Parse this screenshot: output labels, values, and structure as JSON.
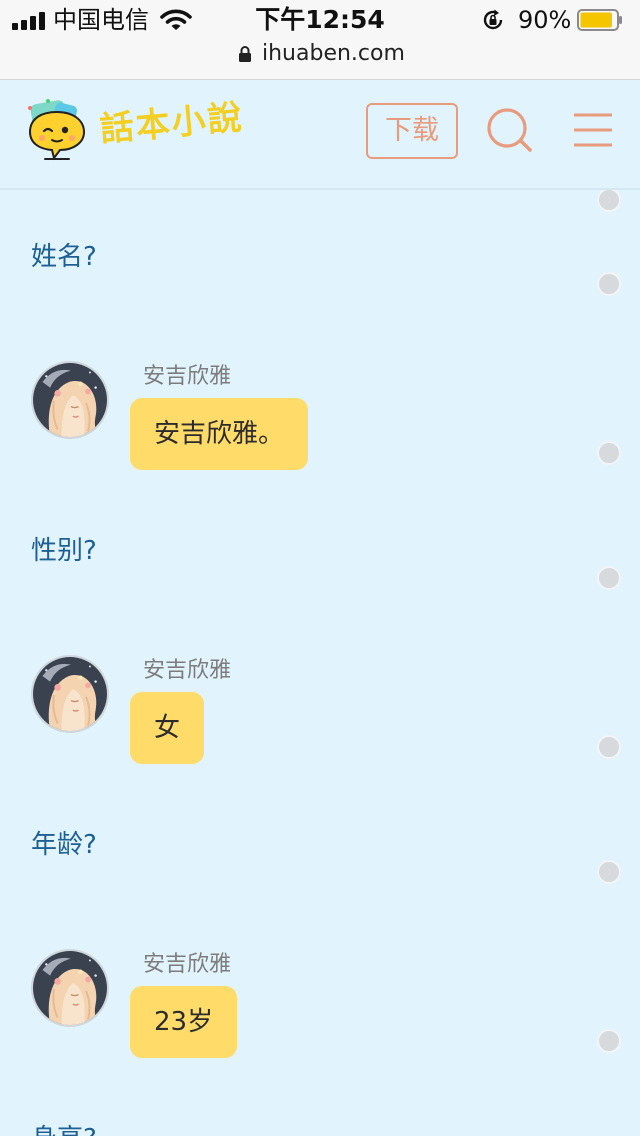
{
  "status_bar": {
    "carrier": "中国电信",
    "time": "下午12:54",
    "battery_percent": "90%",
    "battery_level": 0.9
  },
  "browser": {
    "url": "ihuaben.com"
  },
  "header": {
    "logo_text": "話本小說",
    "download_label": "下载"
  },
  "chat": {
    "entries": [
      {
        "question": "姓名?",
        "speaker": "安吉欣雅",
        "answer": "安吉欣雅。"
      },
      {
        "question": "性别?",
        "speaker": "安吉欣雅",
        "answer": "女"
      },
      {
        "question": "年龄?",
        "speaker": "安吉欣雅",
        "answer": "23岁"
      },
      {
        "question": "身高?"
      }
    ]
  },
  "colors": {
    "page_background": "#e1f4fd",
    "accent_orange": "#e99b7d",
    "bubble_yellow": "#ffdb6a",
    "question_blue": "#1e5f94",
    "logo_yellow": "#f3cf24"
  }
}
